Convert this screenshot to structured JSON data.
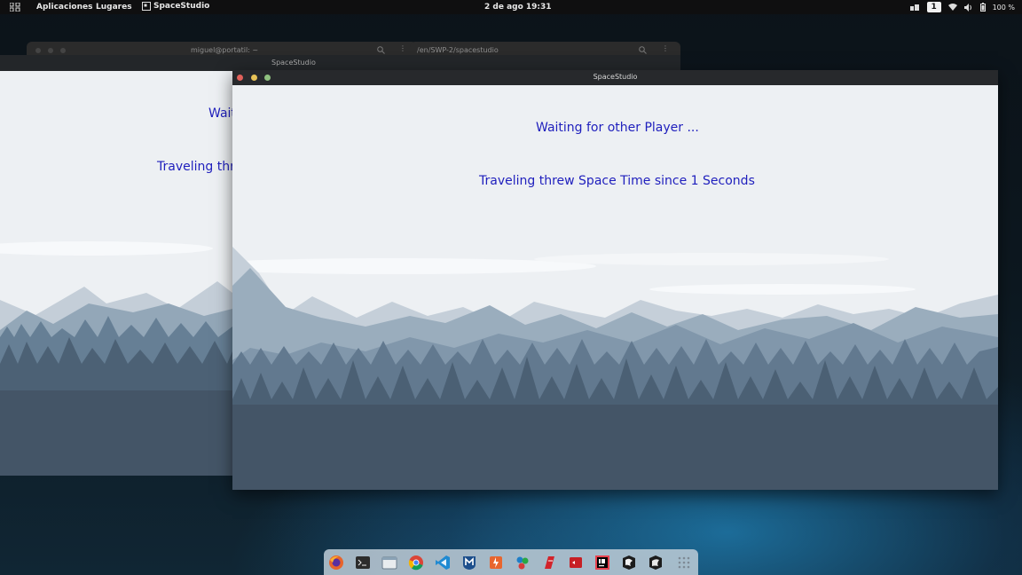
{
  "topbar": {
    "applications_label": "Aplicaciones",
    "places_label": "Lugares",
    "active_app_label": "SpaceStudio",
    "clock": "2 de ago  19:31",
    "workspace_number": "1",
    "battery_text": "100 %"
  },
  "terminals": {
    "left_title": "miguel@portatil: ~",
    "right_title": "/en/SWP-2/spacestudio"
  },
  "back_window": {
    "title": "SpaceStudio",
    "waiting_text": "Waiting for other Player ...",
    "traveling_text": "Traveling threw Space Time since 1 Seconds"
  },
  "front_window": {
    "title": "SpaceStudio",
    "waiting_text": "Waiting for other Player ...",
    "traveling_text": "Traveling threw Space Time since 1 Seconds"
  },
  "dock": {
    "items": [
      "firefox-icon",
      "terminal-icon",
      "files-icon",
      "chrome-icon",
      "vscode-icon",
      "metasploit-icon",
      "burpsuite-icon",
      "maltego-icon",
      "faraday-icon",
      "app-red-icon",
      "intellij-icon",
      "kali-icon",
      "kali-alt-icon",
      "show-apps-icon"
    ]
  },
  "colors": {
    "message_text": "#1f1fbd",
    "title_bar": "#27292c",
    "close": "#e0605a",
    "minimize": "#e8c357",
    "maximize": "#8fc17f"
  }
}
